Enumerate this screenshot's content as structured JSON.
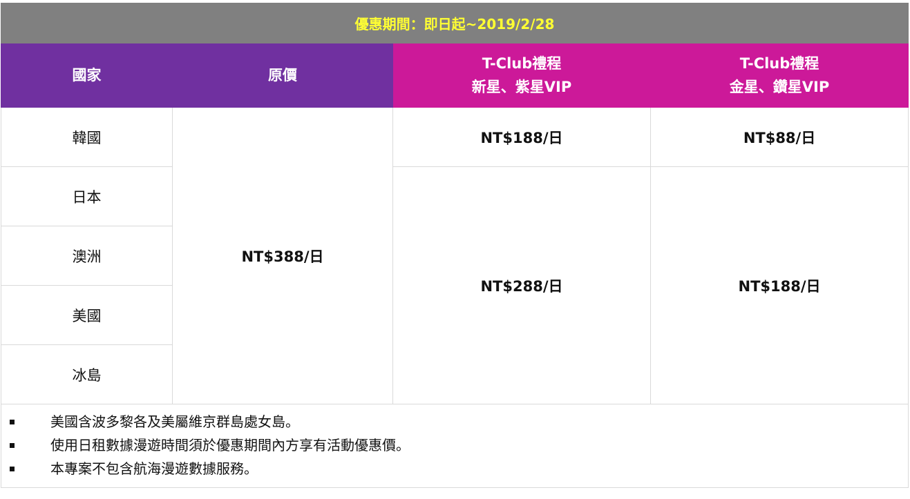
{
  "banner": {
    "text": "優惠期間：即日起~2019/2/28"
  },
  "headers": {
    "country": "國家",
    "original_price": "原價",
    "tier1_line1": "T-Club禮程",
    "tier1_line2": "新星、紫星VIP",
    "tier2_line1": "T-Club禮程",
    "tier2_line2": "金星、鑽星VIP"
  },
  "countries": [
    "韓國",
    "日本",
    "澳洲",
    "美國",
    "冰島"
  ],
  "prices": {
    "original": "NT$388/日",
    "korea_tier1": "NT$188/日",
    "korea_tier2": "NT$88/日",
    "others_tier1": "NT$288/日",
    "others_tier2": "NT$188/日"
  },
  "notes": [
    "美國含波多黎各及美屬維京群島處女島。",
    "使用日租數據漫遊時間須於優惠期間內方享有活動優惠價。",
    "本專案不包含航海漫遊數據服務。"
  ],
  "colors": {
    "banner_bg": "#808080",
    "banner_text": "#ffff33",
    "header_purple": "#7030a0",
    "header_magenta": "#cc1999"
  }
}
